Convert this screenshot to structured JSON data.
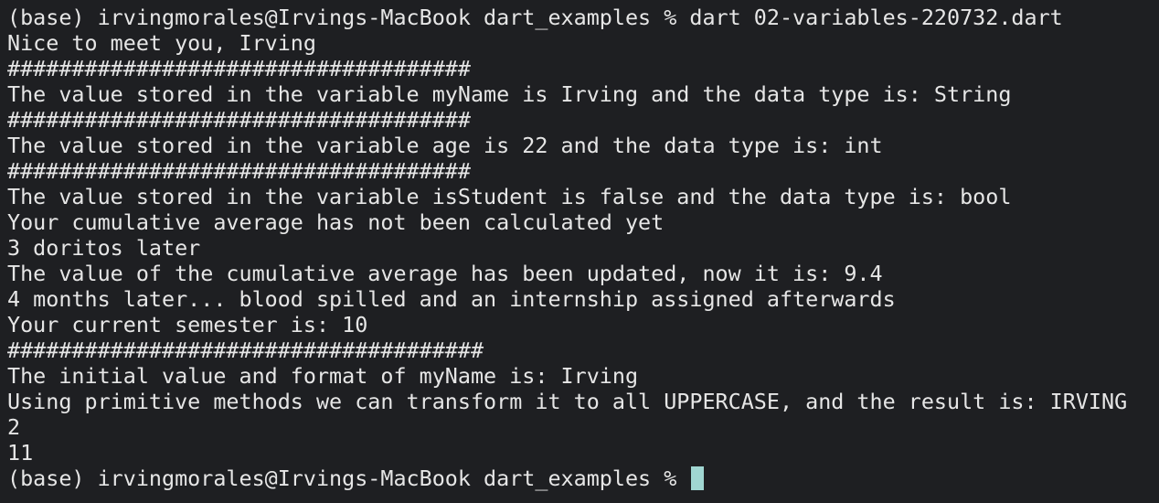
{
  "terminal": {
    "lines": [
      "(base) irvingmorales@Irvings-MacBook dart_examples % dart 02-variables-220732.dart",
      "Nice to meet you, Irving",
      "####################################",
      "The value stored in the variable myName is Irving and the data type is: String",
      "####################################",
      "The value stored in the variable age is 22 and the data type is: int",
      "####################################",
      "The value stored in the variable isStudent is false and the data type is: bool",
      "Your cumulative average has not been calculated yet",
      "3 doritos later",
      "The value of the cumulative average has been updated, now it is: 9.4",
      "4 months later... blood spilled and an internship assigned afterwards",
      "Your current semester is: 10",
      "#####################################",
      "The initial value and format of myName is: Irving",
      "Using primitive methods we can transform it to all UPPERCASE, and the result is: IRVING",
      "2",
      "11"
    ],
    "prompt": "(base) irvingmorales@Irvings-MacBook dart_examples % ",
    "colors": {
      "background": "#1e1f22",
      "text": "#e6e6e6",
      "cursor": "#a0d6d2"
    }
  }
}
